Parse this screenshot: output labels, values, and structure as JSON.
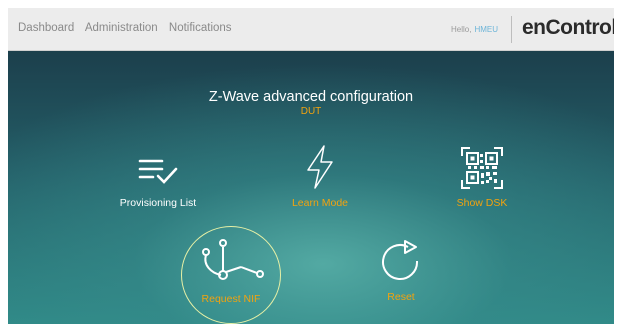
{
  "nav": {
    "items": [
      "Dashboard",
      "Administration",
      "Notifications"
    ]
  },
  "header": {
    "greeting": "Hello,",
    "user": "HMEU",
    "logo": "enControl",
    "logo_mark": "®"
  },
  "page": {
    "title": "Z-Wave advanced configuration",
    "subtitle": "DUT"
  },
  "tiles": [
    {
      "label": "Provisioning List",
      "icon": "list-check-icon"
    },
    {
      "label": "Learn Mode",
      "icon": "lightning-icon"
    },
    {
      "label": "Show DSK",
      "icon": "qr-code-icon"
    },
    {
      "label": "Request NIF",
      "icon": "network-nodes-icon",
      "selected": true
    },
    {
      "label": "Reset",
      "icon": "reset-icon"
    }
  ],
  "colors": {
    "accent": "#f2a30f",
    "user": "#6db5d8",
    "selection_ring": "#e6f0a6"
  }
}
